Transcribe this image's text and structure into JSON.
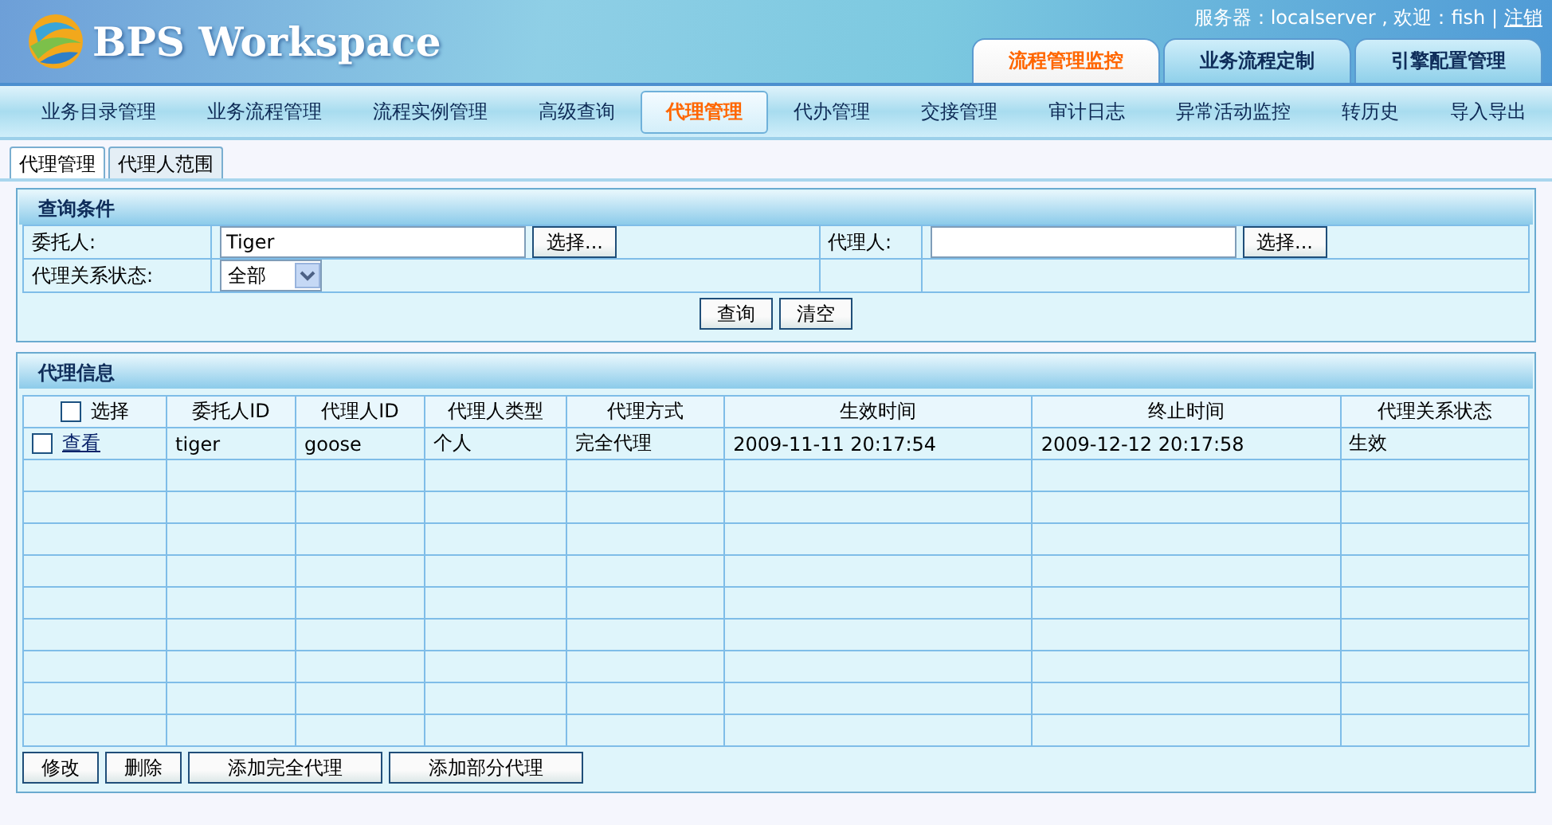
{
  "header": {
    "logo_text": "BPS Workspace",
    "server_info": "服务器：localserver , 欢迎：fish |",
    "logout_link": "注销",
    "tabs": [
      {
        "label": "流程管理监控",
        "selected": true
      },
      {
        "label": "业务流程定制",
        "selected": false
      },
      {
        "label": "引擎配置管理",
        "selected": false
      }
    ]
  },
  "nav": [
    {
      "label": "业务目录管理",
      "selected": false
    },
    {
      "label": "业务流程管理",
      "selected": false
    },
    {
      "label": "流程实例管理",
      "selected": false
    },
    {
      "label": "高级查询",
      "selected": false
    },
    {
      "label": "代理管理",
      "selected": true
    },
    {
      "label": "代办管理",
      "selected": false
    },
    {
      "label": "交接管理",
      "selected": false
    },
    {
      "label": "审计日志",
      "selected": false
    },
    {
      "label": "异常活动监控",
      "selected": false
    },
    {
      "label": "转历史",
      "selected": false
    },
    {
      "label": "导入导出",
      "selected": false
    }
  ],
  "subtabs": [
    {
      "label": "代理管理",
      "selected": true
    },
    {
      "label": "代理人范围",
      "selected": false
    }
  ],
  "query_panel": {
    "title": "查询条件",
    "fields": [
      {
        "label": "委托人:",
        "value": "Tiger",
        "button": "选择..."
      },
      {
        "label": "代理人:",
        "button": "选择..."
      }
    ],
    "status": {
      "label": "代理关系状态:",
      "value": "全部"
    },
    "buttons": [
      "查询",
      "清空"
    ]
  },
  "info_panel": {
    "title": "代理信息",
    "select_all": {
      "label": "选择",
      "checked": false
    },
    "columns": [
      "委托人ID",
      "代理人ID",
      "代理人类型",
      "代理方式",
      "生效时间",
      "终止时间",
      "代理关系状态"
    ],
    "rows": [
      {
        "checked": false,
        "link": "查看",
        "cells": [
          "tiger",
          "goose",
          "个人",
          "完全代理",
          "2009-11-11 20:17:54",
          "2009-12-12 20:17:58",
          "生效"
        ]
      }
    ],
    "buttons": [
      "修改",
      "删除",
      "添加完全代理",
      "添加部分代理"
    ]
  }
}
